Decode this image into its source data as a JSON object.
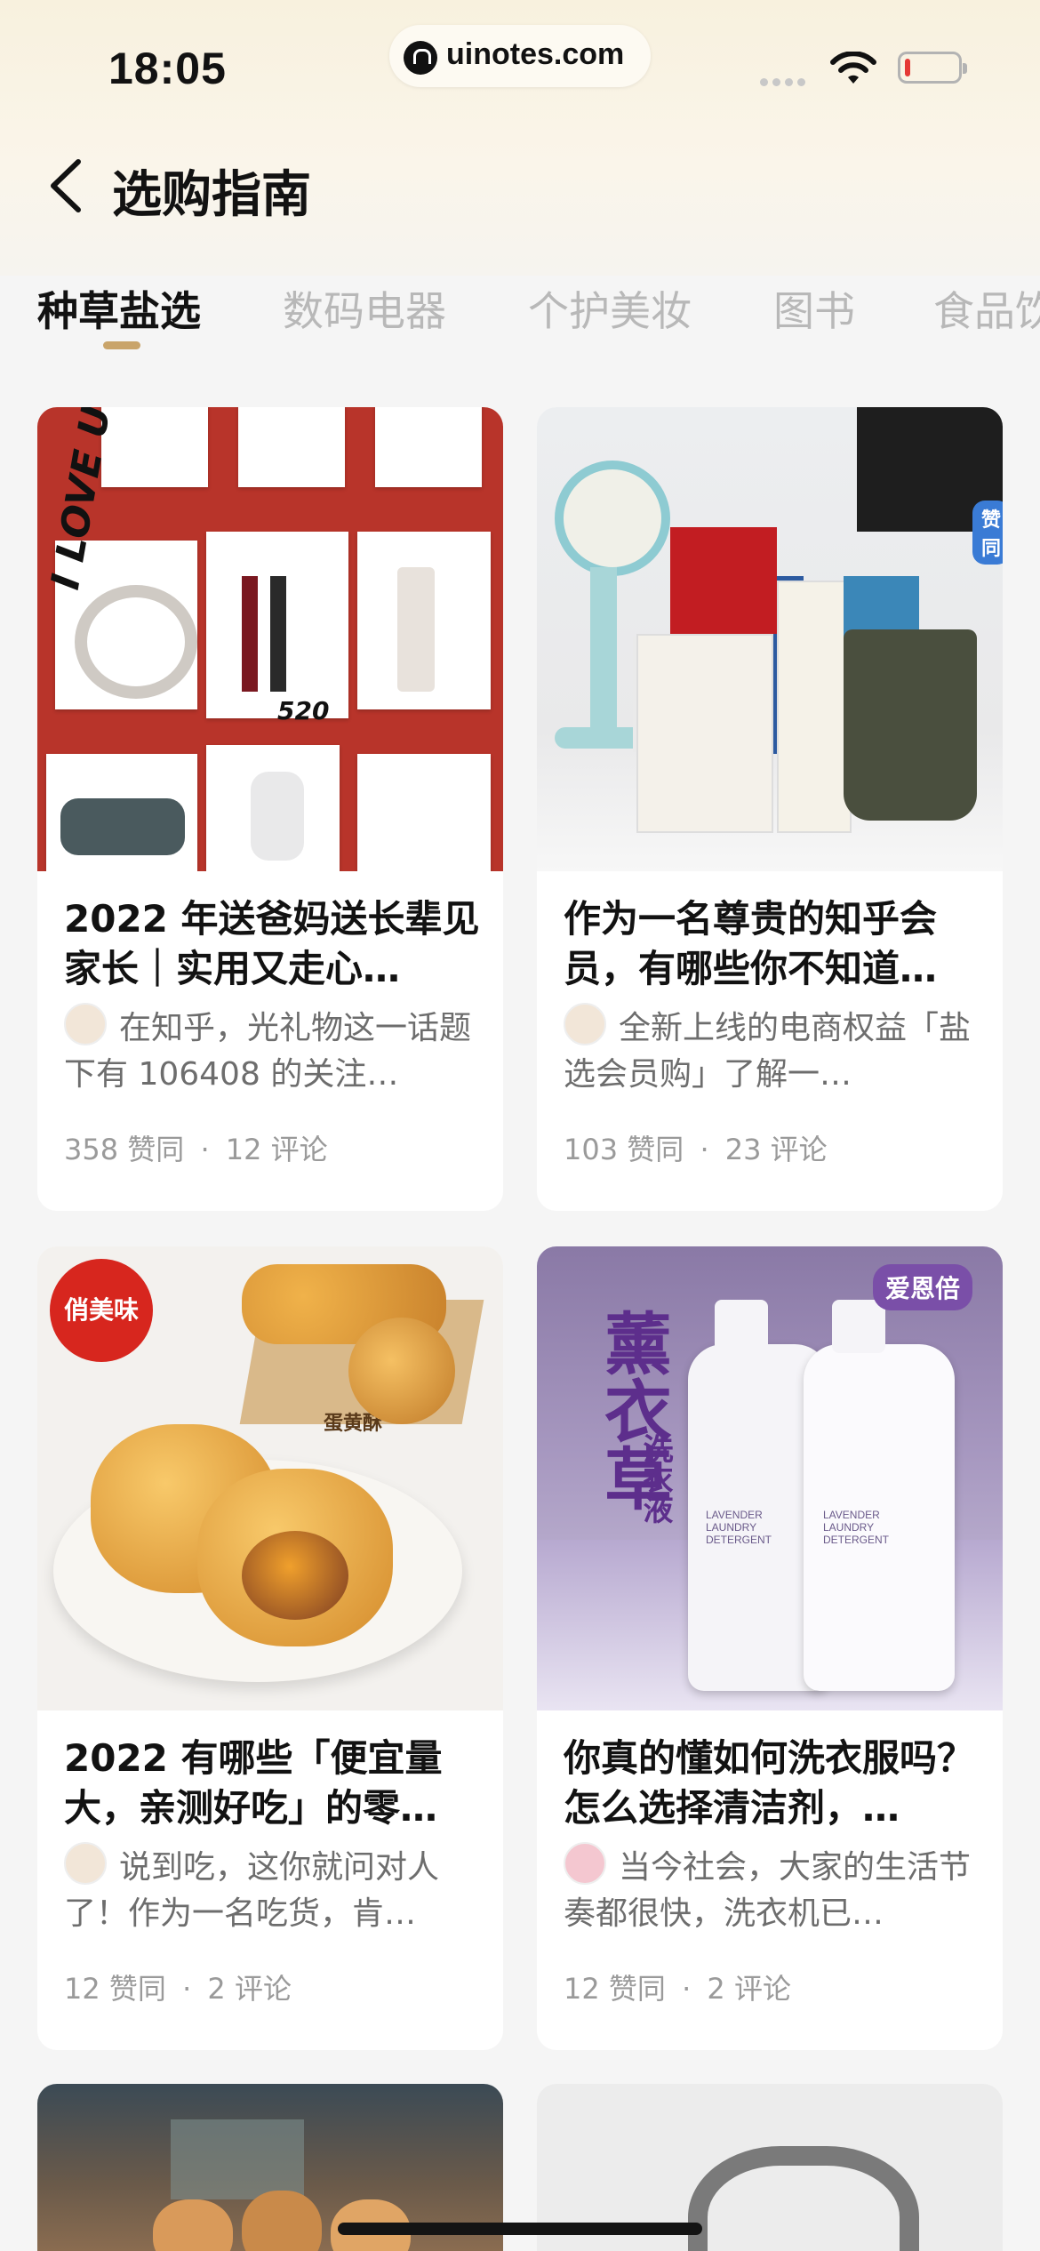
{
  "status_bar": {
    "time": "18:05",
    "url": "uinotes.com",
    "battery_level_fraction": 0.1,
    "battery_color": "#e53935"
  },
  "nav": {
    "back_icon": "chevron-left-icon",
    "title": "选购指南"
  },
  "tabs": [
    {
      "label": "种草盐选",
      "active": true
    },
    {
      "label": "数码电器",
      "active": false
    },
    {
      "label": "个护美妆",
      "active": false
    },
    {
      "label": "图书",
      "active": false
    },
    {
      "label": "食品饮",
      "active": false
    }
  ],
  "accent_color": "#c9a46a",
  "cards": [
    {
      "title": "2022 年送爸妈送长辈见家长｜实用又走心…",
      "excerpt": "在知乎，光礼物这一话题下有 106408 的关注…",
      "likes": "358 赞同",
      "comments": "12 评论",
      "image_text": [
        "I LOVE U",
        "520"
      ]
    },
    {
      "title": "作为一名尊贵的知乎会员，有哪些你不知道…",
      "excerpt": "全新上线的电商权益「盐选会员购」了解一…",
      "likes": "103 赞同",
      "comments": "23 评论",
      "image_text": [
        "赞同"
      ]
    },
    {
      "title": "2022 有哪些「便宜量大，亲测好吃」的零…",
      "excerpt": "说到吃，这你就问对人了！作为一名吃货，肯…",
      "likes": "12 赞同",
      "comments": "2 评论",
      "image_text": [
        "俏美味",
        "蛋黄酥"
      ]
    },
    {
      "title": "你真的懂如何洗衣服吗？怎么选择清洁剂，…",
      "excerpt": "当今社会，大家的生活节奏都很快，洗衣机已…",
      "likes": "12 赞同",
      "comments": "2 评论",
      "image_text": [
        "爱恩倍",
        "薰衣草",
        "洗衣液",
        "LAVENDER LAUNDRY DETERGENT"
      ]
    }
  ],
  "separator": "·"
}
